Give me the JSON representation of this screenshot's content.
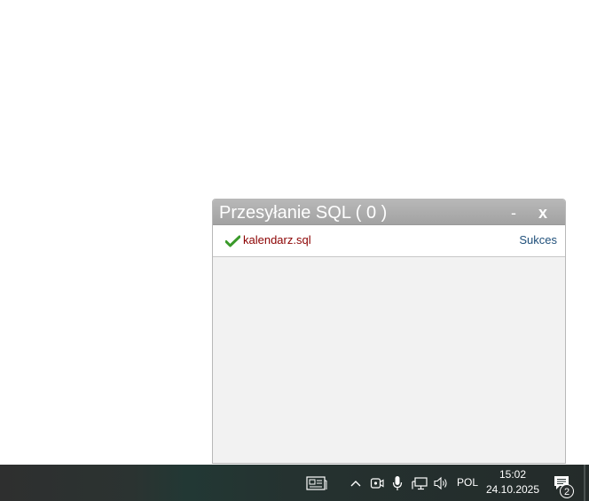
{
  "upload_panel": {
    "title": "Przesyłanie SQL ( 0 )",
    "minimize_label": "-",
    "close_label": "x",
    "files": [
      {
        "name": "kalendarz.sql",
        "status": "Sukces",
        "status_icon": "check-icon"
      }
    ]
  },
  "taskbar": {
    "news_icon": "news-widget-icon",
    "tray_icons": [
      "chevron-up-icon",
      "camera-icon",
      "microphone-icon",
      "network-icon",
      "volume-icon"
    ],
    "language": "POL",
    "time": "15:02",
    "date": "24.10.2025",
    "notification_count": "2"
  },
  "colors": {
    "panel_header": "#a8a8a8",
    "panel_body": "#f2f2f2",
    "file_name": "#8b0000",
    "status_text": "#1f4f7a",
    "check_green": "#3a9a2a",
    "taskbar": "#253230"
  }
}
